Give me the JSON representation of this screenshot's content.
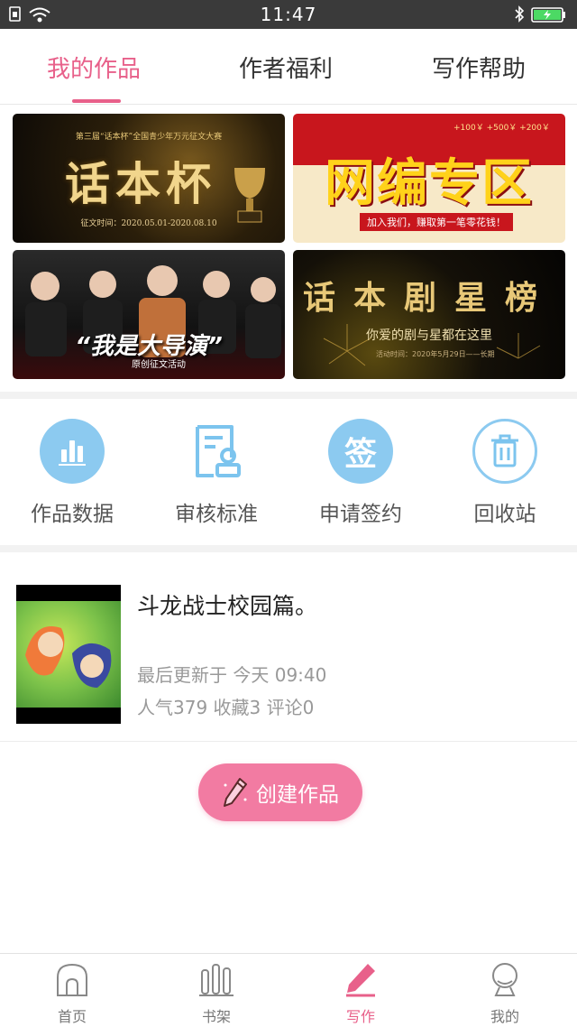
{
  "status_bar": {
    "time": "11:47"
  },
  "tabs": [
    {
      "label": "我的作品"
    },
    {
      "label": "作者福利"
    },
    {
      "label": "写作帮助"
    }
  ],
  "banners": [
    {
      "title": "话本杯",
      "top_text": "第三届“话本杯”全国青少年万元征文大赛",
      "sub_text": "征文时间：2020.05.01-2020.08.10"
    },
    {
      "title": "网编专区",
      "top_text": "+100￥  +500￥  +200￥",
      "sub_text": "加入我们，赚取第一笔零花钱！"
    },
    {
      "title": "“我是大导演”",
      "sub_text": "原创征文活动"
    },
    {
      "title": "话本剧星榜",
      "sub_text": "你爱的剧与星都在这里",
      "small_text": "活动时间：2020年5月29日——长期"
    }
  ],
  "tools": [
    {
      "label": "作品数据",
      "icon": "bar-chart-icon"
    },
    {
      "label": "审核标准",
      "icon": "review-doc-icon"
    },
    {
      "label": "申请签约",
      "icon": "sign-icon",
      "icon_char": "签"
    },
    {
      "label": "回收站",
      "icon": "trash-icon"
    }
  ],
  "work": {
    "title": "斗龙战士校园篇。",
    "updated": "最后更新于 今天 09:40",
    "stats": "人气379 收藏3 评论0"
  },
  "create_button": {
    "label": "创建作品"
  },
  "bottom_nav": [
    {
      "label": "首页",
      "icon": "home-icon"
    },
    {
      "label": "书架",
      "icon": "bookshelf-icon"
    },
    {
      "label": "写作",
      "icon": "write-icon"
    },
    {
      "label": "我的",
      "icon": "profile-icon"
    }
  ],
  "colors": {
    "accent": "#e8608a",
    "button": "#f27ba2",
    "tool_blue": "#7cc4ee"
  }
}
